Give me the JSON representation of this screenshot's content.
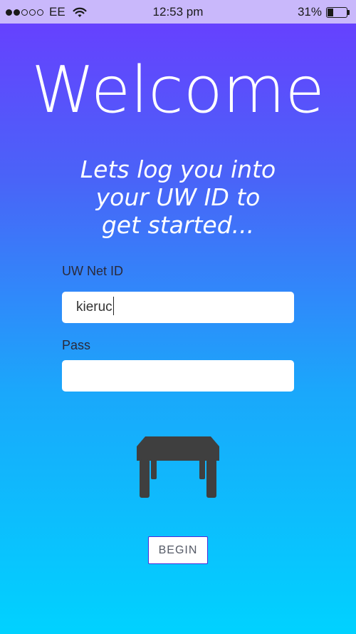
{
  "status_bar": {
    "carrier": "EE",
    "time": "12:53 pm",
    "battery_percent": "31%",
    "battery_level": 0.31,
    "signal_bars": 2,
    "signal_total": 5
  },
  "welcome": {
    "title": "Welcome",
    "subtitle_line1": "Lets log you into",
    "subtitle_line2": "your UW ID to",
    "subtitle_line3": "get started..."
  },
  "form": {
    "netid_label": "UW Net ID",
    "netid_value": "kieruc",
    "pass_label": "Pass",
    "pass_value": ""
  },
  "icon": {
    "name": "desk-icon",
    "color": "#3f3f3f"
  },
  "actions": {
    "begin_label": "BEGIN"
  },
  "colors": {
    "gradient_top": "#6a3cff",
    "gradient_bottom": "#00d2ff",
    "button_border": "#4b2bd8"
  }
}
